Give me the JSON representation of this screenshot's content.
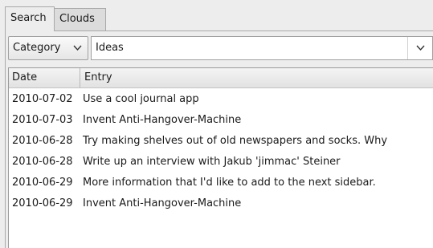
{
  "tabs": [
    {
      "label": "Search",
      "active": true
    },
    {
      "label": "Clouds",
      "active": false
    }
  ],
  "filter": {
    "category_label": "Category",
    "search_value": "Ideas"
  },
  "columns": {
    "date": "Date",
    "entry": "Entry"
  },
  "rows": [
    {
      "date": "2010-07-02",
      "entry": "Use a cool journal app"
    },
    {
      "date": "2010-07-03",
      "entry": "Invent Anti-Hangover-Machine"
    },
    {
      "date": "2010-06-28",
      "entry": "Try making shelves out of old newspapers and socks. Why"
    },
    {
      "date": "2010-06-28",
      "entry": "Write up an interview with Jakub 'jimmac' Steiner"
    },
    {
      "date": "2010-06-29",
      "entry": "More information that I'd like to add to the next sidebar."
    },
    {
      "date": "2010-06-29",
      "entry": "Invent Anti-Hangover-Machine"
    }
  ],
  "icons": {
    "category_dropdown": "chevron-down-icon",
    "search_dropdown": "chevron-down-icon"
  }
}
